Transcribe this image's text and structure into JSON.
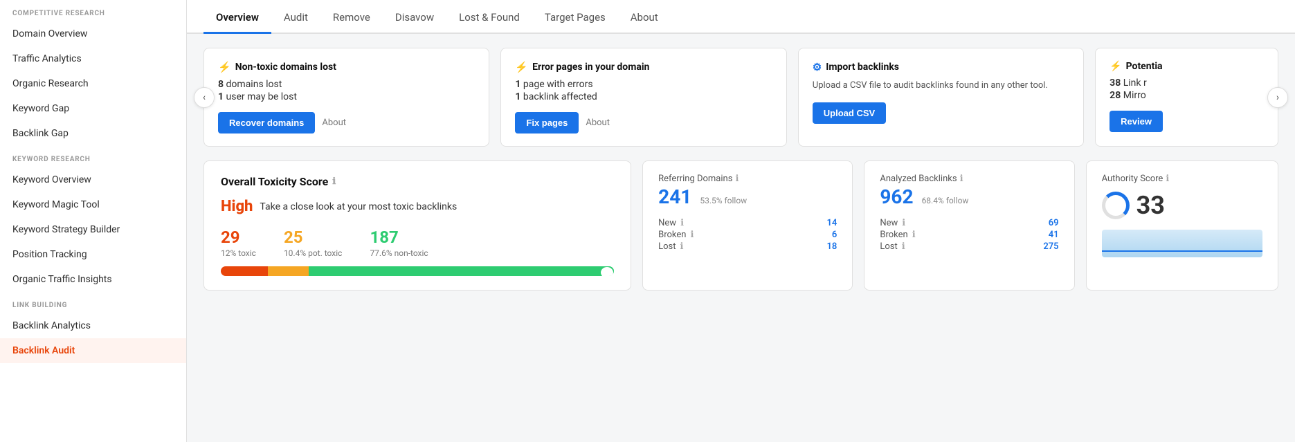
{
  "sidebar": {
    "sections": [
      {
        "label": "COMPETITIVE RESEARCH",
        "items": [
          {
            "id": "domain-overview",
            "label": "Domain Overview",
            "active": false
          },
          {
            "id": "traffic-analytics",
            "label": "Traffic Analytics",
            "active": false
          },
          {
            "id": "organic-research",
            "label": "Organic Research",
            "active": false
          },
          {
            "id": "keyword-gap",
            "label": "Keyword Gap",
            "active": false
          },
          {
            "id": "backlink-gap",
            "label": "Backlink Gap",
            "active": false
          }
        ]
      },
      {
        "label": "KEYWORD RESEARCH",
        "items": [
          {
            "id": "keyword-overview",
            "label": "Keyword Overview",
            "active": false
          },
          {
            "id": "keyword-magic-tool",
            "label": "Keyword Magic Tool",
            "active": false
          },
          {
            "id": "keyword-strategy-builder",
            "label": "Keyword Strategy Builder",
            "active": false
          },
          {
            "id": "position-tracking",
            "label": "Position Tracking",
            "active": false
          },
          {
            "id": "organic-traffic-insights",
            "label": "Organic Traffic Insights",
            "active": false
          }
        ]
      },
      {
        "label": "LINK BUILDING",
        "items": [
          {
            "id": "backlink-analytics",
            "label": "Backlink Analytics",
            "active": false
          },
          {
            "id": "backlink-audit",
            "label": "Backlink Audit",
            "active": true
          }
        ]
      }
    ]
  },
  "tabs": [
    {
      "id": "overview",
      "label": "Overview",
      "active": true
    },
    {
      "id": "audit",
      "label": "Audit",
      "active": false
    },
    {
      "id": "remove",
      "label": "Remove",
      "active": false
    },
    {
      "id": "disavow",
      "label": "Disavow",
      "active": false
    },
    {
      "id": "lost-found",
      "label": "Lost & Found",
      "active": false
    },
    {
      "id": "target-pages",
      "label": "Target Pages",
      "active": false
    },
    {
      "id": "about",
      "label": "About",
      "active": false
    }
  ],
  "alert_cards": [
    {
      "id": "non-toxic-lost",
      "icon": "bolt",
      "icon_color": "red",
      "title": "Non-toxic domains lost",
      "stats": [
        {
          "value": "8",
          "label": "domains lost"
        },
        {
          "value": "1",
          "label": "user may be lost"
        }
      ],
      "button_label": "Recover domains",
      "about_label": "About"
    },
    {
      "id": "error-pages",
      "icon": "bolt",
      "icon_color": "red",
      "title": "Error pages in your domain",
      "stats": [
        {
          "value": "1",
          "label": "page with errors"
        },
        {
          "value": "1",
          "label": "backlink affected"
        }
      ],
      "button_label": "Fix pages",
      "about_label": "About"
    },
    {
      "id": "import-backlinks",
      "icon": "gear",
      "icon_color": "blue",
      "title": "Import backlinks",
      "description": "Upload a CSV file to audit backlinks found in any other tool.",
      "button_label": "Upload CSV"
    },
    {
      "id": "potential",
      "icon": "bolt",
      "icon_color": "orange",
      "title": "Potentia",
      "stats": [
        {
          "value": "38",
          "label": "Link r"
        },
        {
          "value": "28",
          "label": "Mirro"
        }
      ],
      "button_label": "Review",
      "partial": true
    }
  ],
  "nav_arrow_left": "‹",
  "nav_arrow_right": "›",
  "toxicity": {
    "title": "Overall Toxicity Score",
    "level": "High",
    "description": "Take a close look at your most toxic backlinks",
    "stats": [
      {
        "value": "29",
        "label": "12% toxic",
        "color": "red"
      },
      {
        "value": "25",
        "label": "10.4% pot. toxic",
        "color": "orange"
      },
      {
        "value": "187",
        "label": "77.6% non-toxic",
        "color": "green"
      }
    ],
    "bar_red_pct": 12,
    "bar_orange_pct": 10.4,
    "bar_green_pct": 77.6
  },
  "referring_domains": {
    "title": "Referring Domains",
    "value": "241",
    "follow": "53.5% follow",
    "new_label": "New",
    "new_value": "14",
    "broken_label": "Broken",
    "broken_value": "6",
    "lost_label": "Lost",
    "lost_value": "18"
  },
  "analyzed_backlinks": {
    "title": "Analyzed Backlinks",
    "value": "962",
    "follow": "68.4% follow",
    "new_label": "New",
    "new_value": "69",
    "broken_label": "Broken",
    "broken_value": "41",
    "lost_label": "Lost",
    "lost_value": "275"
  },
  "authority_score": {
    "title": "Authority Score",
    "value": "33"
  },
  "info_icon": "ℹ"
}
